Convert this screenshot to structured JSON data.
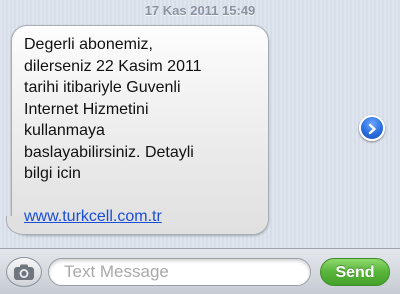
{
  "thread": {
    "timestamp": "17 Kas 2011 15:49",
    "message": {
      "text": "Degerli abonemiz,\ndilerseniz 22 Kasim 2011\ntarihi itibariyle Guvenli\nInternet Hizmetini\nkullanmaya\nbaslayabilirsiniz. Detayli\nbilgi icin",
      "link": "www.turkcell.com.tr",
      "forward_icon": "chevron-right-icon"
    }
  },
  "compose": {
    "camera_icon": "camera-icon",
    "placeholder": "Text Message",
    "send_label": "Send",
    "send_color": "#58b43a"
  }
}
